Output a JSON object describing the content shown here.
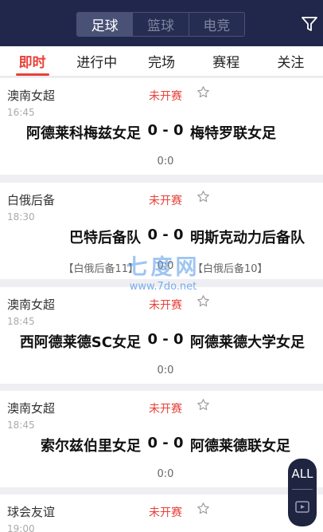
{
  "sport_tabs": [
    {
      "label": "足球",
      "active": true
    },
    {
      "label": "篮球",
      "active": false
    },
    {
      "label": "电竞",
      "active": false
    }
  ],
  "filter_icon": "filter-icon",
  "sub_tabs": [
    {
      "label": "即时",
      "active": true
    },
    {
      "label": "进行中",
      "active": false
    },
    {
      "label": "完场",
      "active": false
    },
    {
      "label": "赛程",
      "active": false
    },
    {
      "label": "关注",
      "active": false
    }
  ],
  "matches": [
    {
      "league": "澳南女超",
      "time": "16:45",
      "status": "未开赛",
      "home": "阿德莱科梅兹女足",
      "score": "0 - 0",
      "away": "梅特罗联女足",
      "half": "0:0",
      "home_rank": "",
      "away_rank": ""
    },
    {
      "league": "白俄后备",
      "time": "18:30",
      "status": "未开赛",
      "home": "巴特后备队",
      "score": "0 - 0",
      "away": "明斯克动力后备队",
      "half": "0:0",
      "home_rank": "【白俄后备11】",
      "away_rank": "【白俄后备10】"
    },
    {
      "league": "澳南女超",
      "time": "18:45",
      "status": "未开赛",
      "home": "西阿德莱德SC女足",
      "score": "0 - 0",
      "away": "阿德莱德大学女足",
      "half": "0:0",
      "home_rank": "",
      "away_rank": ""
    },
    {
      "league": "澳南女超",
      "time": "18:45",
      "status": "未开赛",
      "home": "索尔兹伯里女足",
      "score": "0 - 0",
      "away": "阿德莱德联女足",
      "half": "0:0",
      "home_rank": "",
      "away_rank": ""
    },
    {
      "league": "球会友谊",
      "time": "19:00",
      "status": "未开赛",
      "home": "",
      "score": "",
      "away": "",
      "half": "",
      "home_rank": "",
      "away_rank": ""
    }
  ],
  "watermark": {
    "big": "七度网",
    "small": "www.7do.net"
  },
  "float_button": {
    "label": "ALL",
    "icon": "video-icon"
  },
  "colors": {
    "topbar": "#21274a",
    "accent": "#e8413a",
    "background": "#efeff3"
  }
}
